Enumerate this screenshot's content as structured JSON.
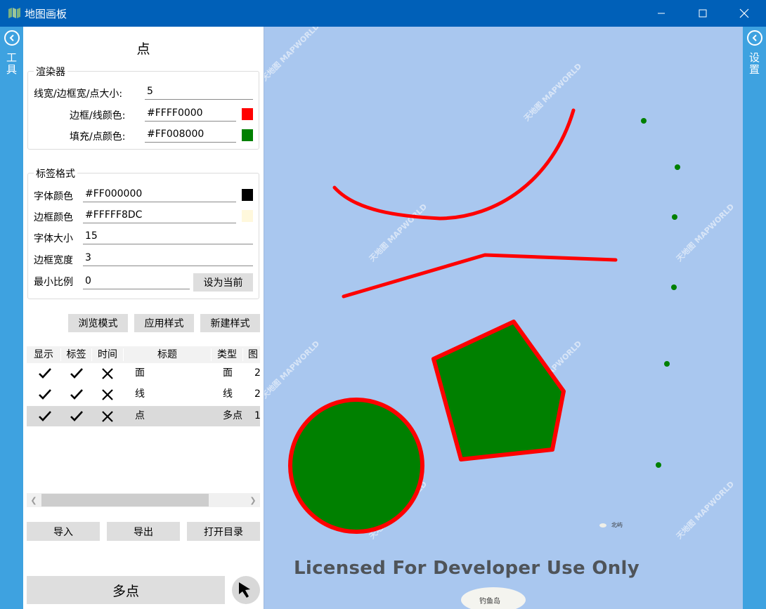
{
  "window": {
    "title": "地图画板"
  },
  "left_edge": {
    "label": "工具"
  },
  "right_edge": {
    "label": "设置"
  },
  "panel": {
    "title": "点",
    "renderer": {
      "legend": "渲染器",
      "line_width_label": "线宽/边框宽/点大小:",
      "line_width_value": "5",
      "stroke_color_label": "边框/线颜色:",
      "stroke_color_value": "#FFFF0000",
      "fill_color_label": "填充/点颜色:",
      "fill_color_value": "#FF008000"
    },
    "label_format": {
      "legend": "标签格式",
      "font_color_label": "字体颜色",
      "font_color_value": "#FF000000",
      "border_color_label": "边框颜色",
      "border_color_value": "#FFFFF8DC",
      "font_size_label": "字体大小",
      "font_size_value": "15",
      "border_width_label": "边框宽度",
      "border_width_value": "3",
      "min_scale_label": "最小比例",
      "min_scale_value": "0",
      "set_current_button": "设为当前"
    },
    "style_buttons": {
      "browse": "浏览模式",
      "apply": "应用样式",
      "new": "新建样式"
    },
    "grid": {
      "headers": [
        "显示",
        "标签",
        "时间",
        "标题",
        "类型",
        "图"
      ],
      "rows": [
        {
          "title": "面",
          "type": "面",
          "count": "2"
        },
        {
          "title": "线",
          "type": "线",
          "count": "2"
        },
        {
          "title": "点",
          "type": "多点",
          "count": "1"
        }
      ]
    },
    "io_buttons": {
      "import": "导入",
      "export": "导出",
      "open_dir": "打开目录"
    },
    "mode_button": "多点"
  },
  "map": {
    "license_text": "Licensed For Developer Use Only",
    "watermark": "天地图 MAPWORLD",
    "labels": {
      "island1": "北屿",
      "island2": "钓鱼岛"
    }
  },
  "colors": {
    "titlebar": "#0060b8",
    "edge": "#3ea2e0",
    "map_bg": "#a9c7ef",
    "stroke": "#ff0000",
    "fill": "#008000",
    "label_border": "#fff8dc"
  }
}
